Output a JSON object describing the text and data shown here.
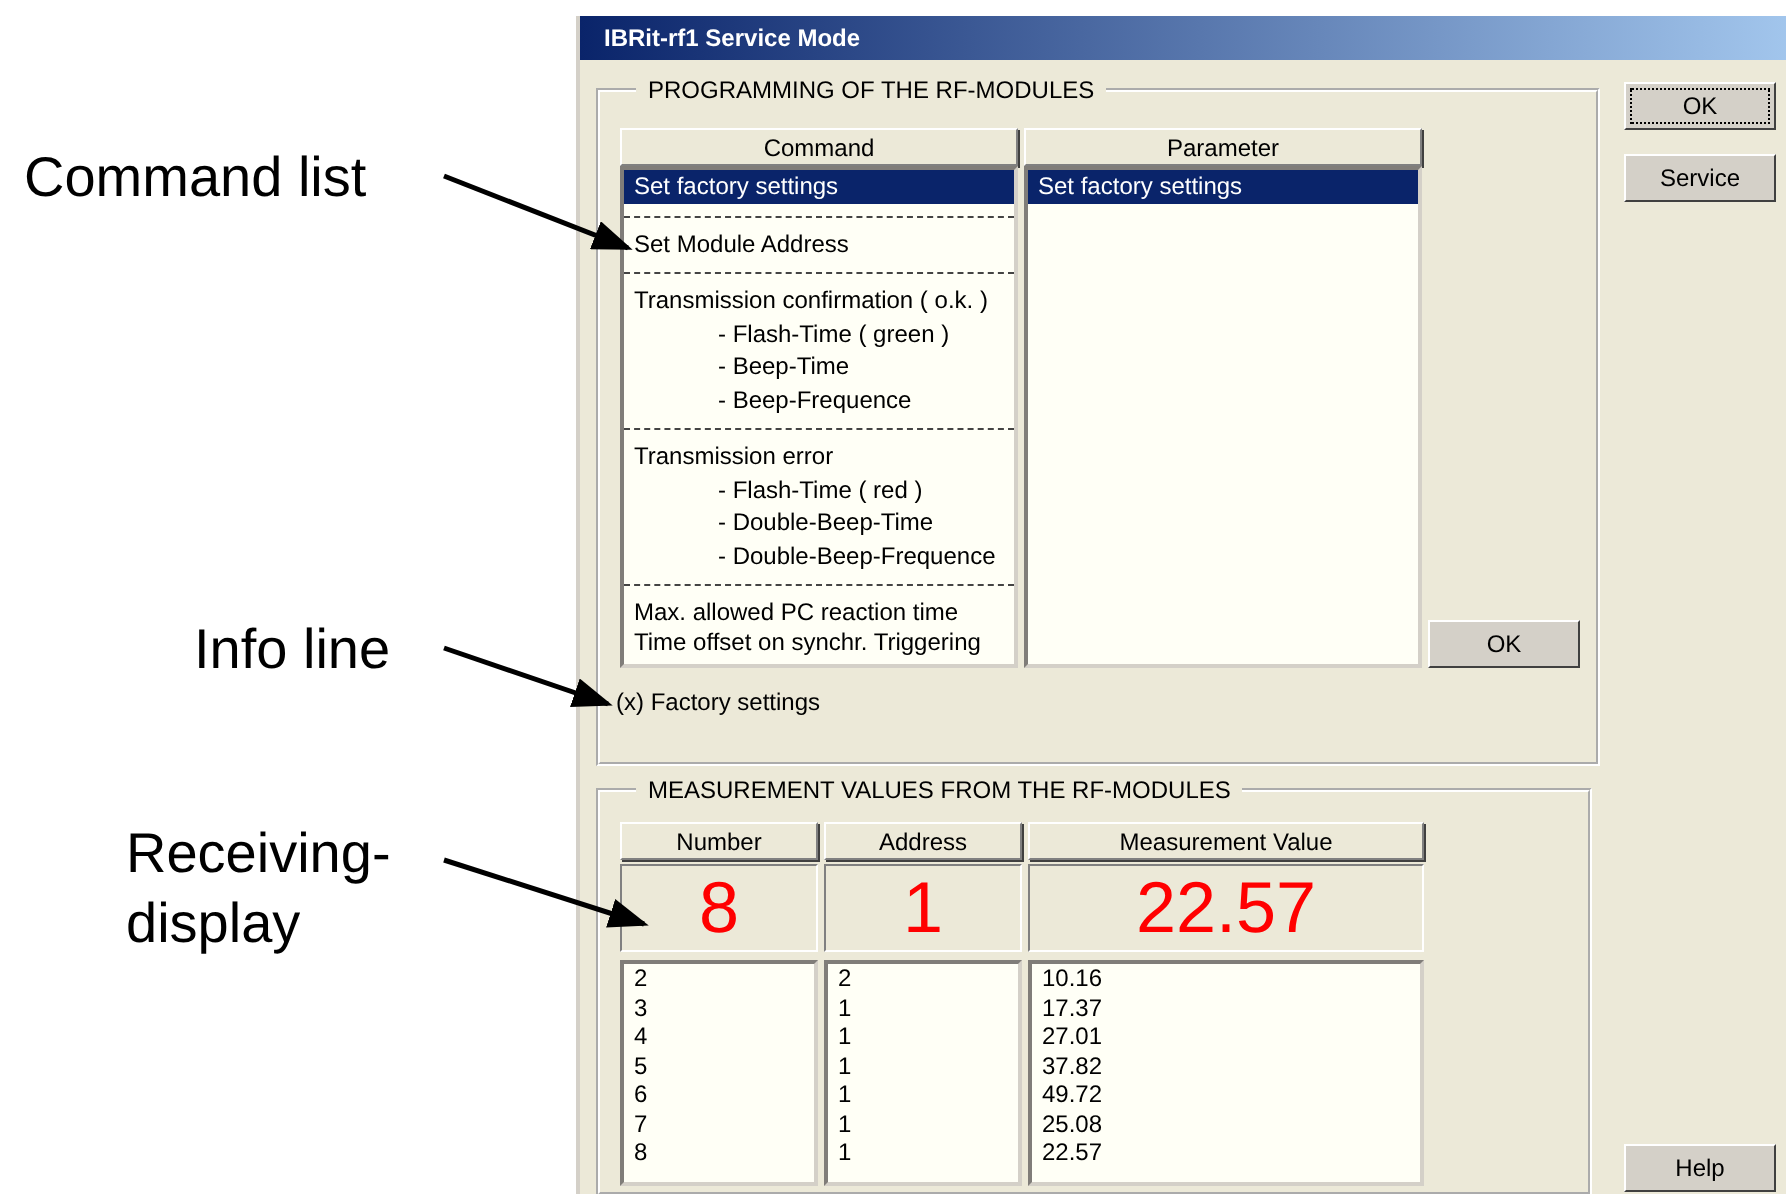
{
  "annotations": [
    {
      "text": "Command list"
    },
    {
      "text": "Info line"
    },
    {
      "text": "Receiving-\ndisplay"
    }
  ],
  "window": {
    "title": "IBRit-rf1 Service Mode"
  },
  "programming": {
    "title": "PROGRAMMING OF THE RF-MODULES",
    "columns": [
      "Command",
      "Parameter"
    ],
    "commands": [
      {
        "text": "Set factory settings",
        "selected": true
      },
      {
        "text": "Set Module Address",
        "selected": false
      },
      {
        "text": "Transmission confirmation ( o.k. )",
        "selected": false,
        "children": [
          {
            "text": "- Flash-Time ( green )"
          },
          {
            "text": "- Beep-Time"
          },
          {
            "text": "- Beep-Frequence"
          }
        ]
      },
      {
        "text": "Transmission error",
        "selected": false,
        "children": [
          {
            "text": "- Flash-Time ( red )"
          },
          {
            "text": "- Double-Beep-Time"
          },
          {
            "text": "- Double-Beep-Frequence"
          }
        ]
      },
      {
        "text": "Max. allowed PC reaction time\nTime offset on synchr. Triggering",
        "selected": false
      }
    ],
    "parameters": [
      {
        "text": "Set factory settings",
        "selected": true
      }
    ],
    "ok_button": "OK",
    "info_line": "(x) Factory settings"
  },
  "measurement": {
    "title": "MEASUREMENT VALUES FROM THE RF-MODULES",
    "columns": [
      "Number",
      "Address",
      "Measurement Value"
    ],
    "current": [
      "8",
      "1",
      "22.57"
    ],
    "rows": [
      [
        "2",
        "2",
        "10.16"
      ],
      [
        "3",
        "1",
        "17.37"
      ],
      [
        "4",
        "1",
        "27.01"
      ],
      [
        "5",
        "1",
        "37.82"
      ],
      [
        "6",
        "1",
        "49.72"
      ],
      [
        "7",
        "1",
        "25.08"
      ],
      [
        "8",
        "1",
        "22.57"
      ]
    ]
  },
  "side_buttons": [
    {
      "label": "OK",
      "focused": true
    },
    {
      "label": "Service",
      "focused": false
    },
    {
      "label": "Help",
      "focused": false
    }
  ]
}
